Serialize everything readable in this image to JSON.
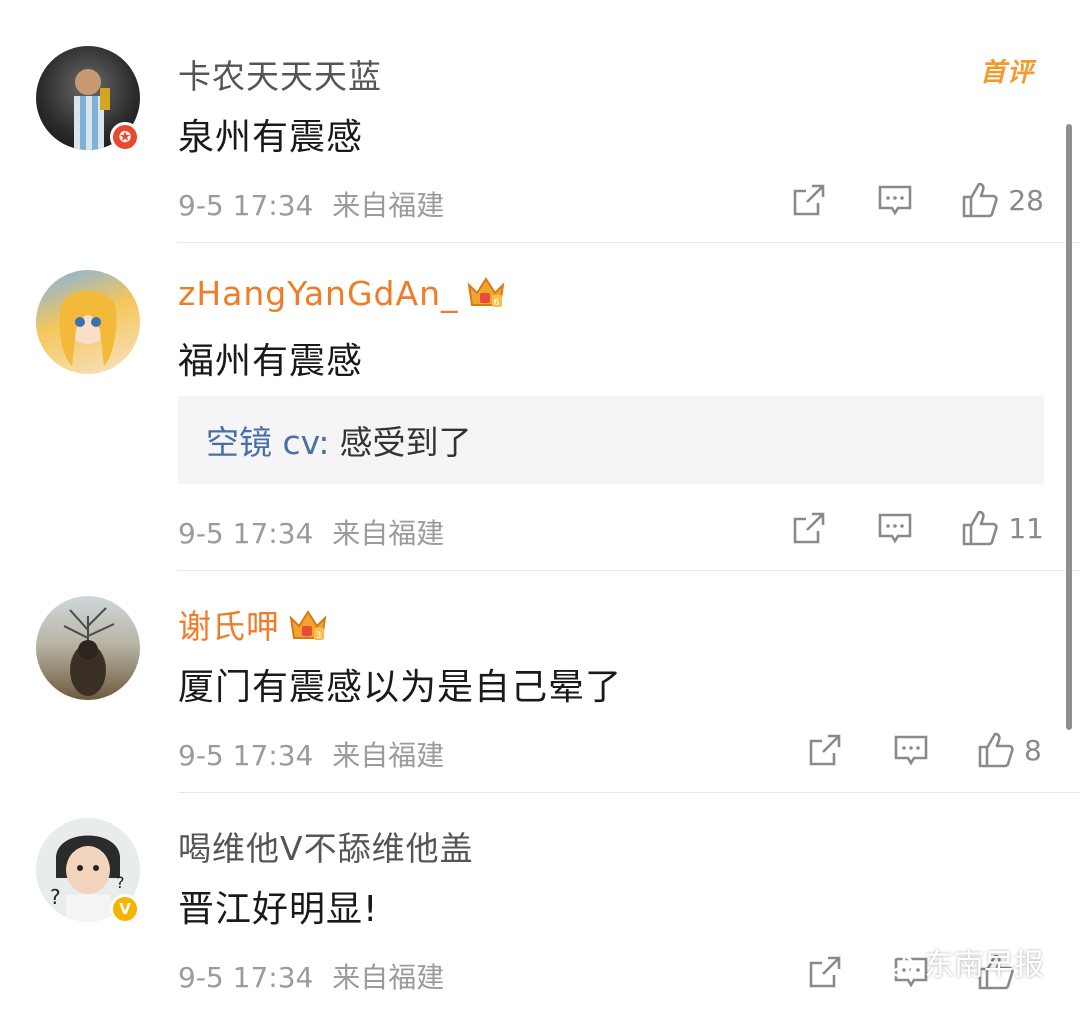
{
  "comments": [
    {
      "username": "卡农天天天蓝",
      "text": "泉州有震感",
      "time": "9-5 17:34",
      "location": "来自福建",
      "likes": "28",
      "tag": "首评",
      "badge_color": "#e8492f"
    },
    {
      "username": "zHangYanGdAn_",
      "text": "福州有震感",
      "time": "9-5 17:34",
      "location": "来自福建",
      "likes": "11",
      "reply": {
        "user": "空镜 cv:",
        "text": "感受到了"
      },
      "crown_level": "6"
    },
    {
      "username": "谢氏呷",
      "text": "厦门有震感以为是自己晕了",
      "time": "9-5 17:34",
      "location": "来自福建",
      "likes": "8",
      "crown_level": "3"
    },
    {
      "username": "喝维他V不舔维他盖",
      "text": "晋江好明显!",
      "time": "9-5 17:34",
      "location": "来自福建",
      "likes": "",
      "badge_color": "#f5b400"
    }
  ],
  "watermark": "东南早报",
  "colors": {
    "vip_name": "#f07c28",
    "reply_user": "#4a6fa5",
    "tag": "#f39a2c"
  }
}
